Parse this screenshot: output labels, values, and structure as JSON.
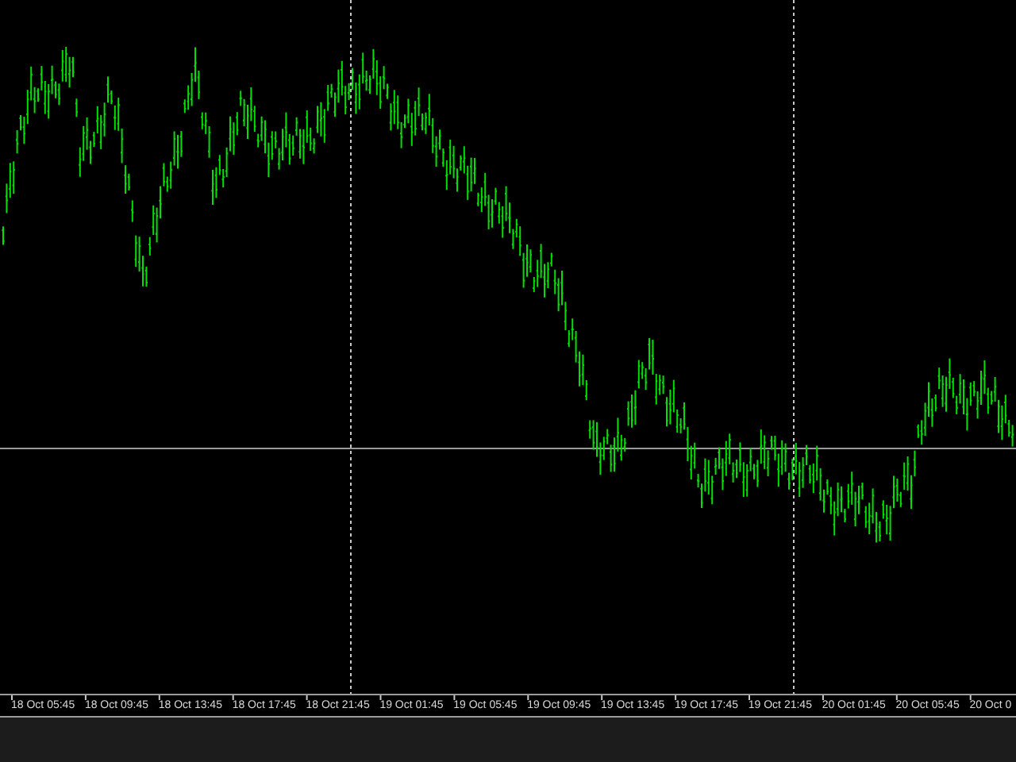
{
  "chart": {
    "time_labels": [
      "18 Oct 05:45",
      "18 Oct 09:45",
      "18 Oct 13:45",
      "18 Oct 17:45",
      "18 Oct 21:45",
      "19 Oct 01:45",
      "19 Oct 05:45",
      "19 Oct 09:45",
      "19 Oct 13:45",
      "19 Oct 17:45",
      "19 Oct 21:45",
      "20 Oct 01:45",
      "20 Oct 05:45",
      "20 Oct 0"
    ]
  }
}
